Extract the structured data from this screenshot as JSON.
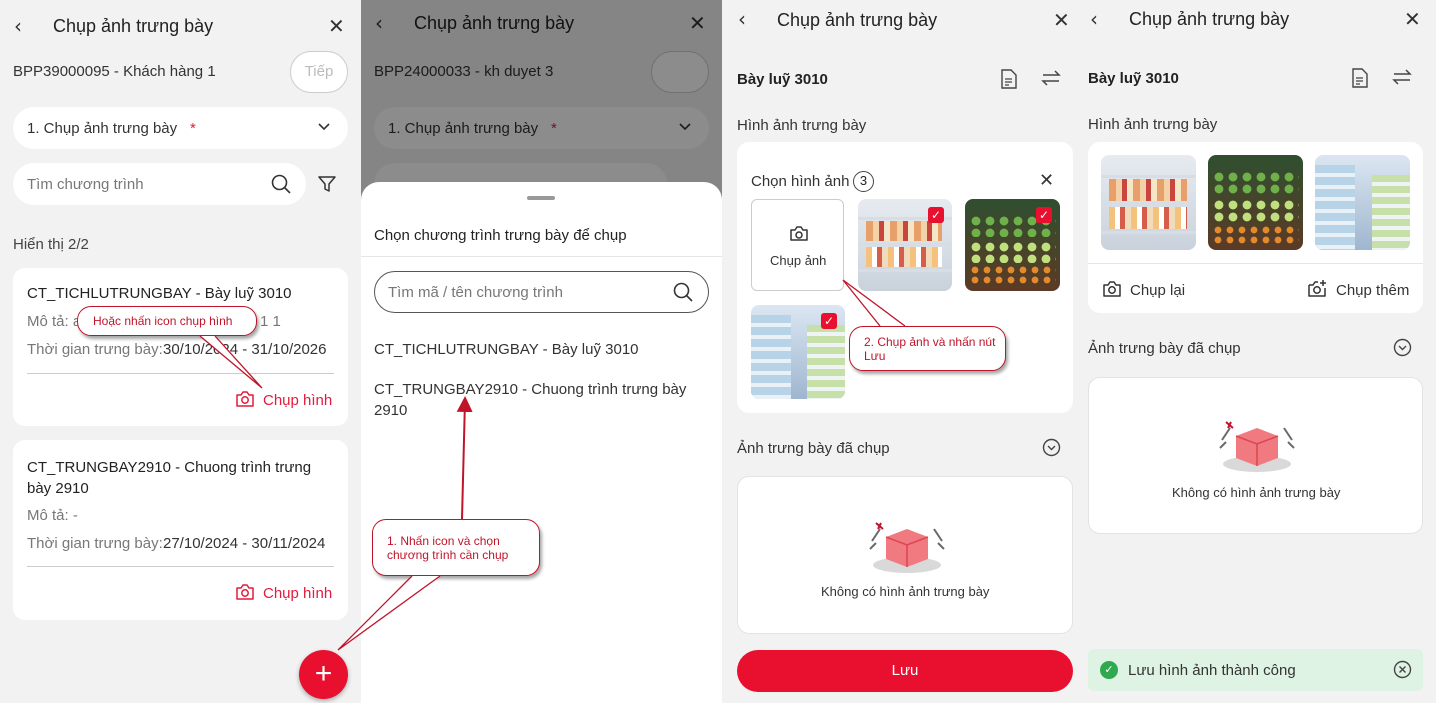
{
  "header": {
    "title": "Chụp ảnh trưng bày"
  },
  "s1": {
    "customer": "BPP39000095 - Khách hàng 1",
    "next_label": "Tiếp",
    "step_select": "1. Chụp ảnh trưng bày",
    "required_mark": "*",
    "search_placeholder": "Tìm chương trình",
    "count_label": "Hiển thị 2/2",
    "programs": [
      {
        "title": "CT_TICHLUTRUNGBAY - Bày luỹ 3010",
        "desc_label": "Mô tả: a",
        "desc_tail": "1 1",
        "time_label": "Thời gian trưng bày:",
        "time_value": "30/10/2024 - 31/10/2026",
        "action": "Chụp hình"
      },
      {
        "title": "CT_TRUNGBAY2910 - Chuong trình trưng bày 2910",
        "desc_label": "Mô tả: -",
        "time_label": "Thời gian trưng bày:",
        "time_value": "27/10/2024 - 30/11/2024",
        "action": "Chụp hình"
      }
    ],
    "fab": "+",
    "annotation": "Hoặc nhấn icon chụp hình"
  },
  "s2": {
    "customer": "BPP24000033 - kh duyet 3",
    "step_select": "1. Chụp ảnh trưng bày",
    "required_mark": "*",
    "sheet_title": "Chọn chương trình trưng bày để chụp",
    "search_placeholder": "Tìm mã / tên chương trình",
    "options": [
      "CT_TICHLUTRUNGBAY - Bày luỹ 3010",
      "CT_TRUNGBAY2910 - Chuong trình trưng bày 2910"
    ],
    "annotation": "1. Nhấn icon và chọn chương trình cần chụp"
  },
  "s3": {
    "program_name": "Bày luỹ 3010",
    "section_title": "Hình ảnh trưng bày",
    "pick_label": "Chọn hình ảnh",
    "pick_count": "3",
    "camera_label": "Chụp ảnh",
    "captured_title": "Ảnh trưng bày đã chụp",
    "empty_text": "Không có hình ảnh trưng bày",
    "save_label": "Lưu",
    "annotation": "2. Chụp ảnh và nhấn nút Lưu"
  },
  "s4": {
    "program_name": "Bày luỹ 3010",
    "section_title": "Hình ảnh trưng bày",
    "retake_label": "Chụp lại",
    "more_label": "Chụp thêm",
    "captured_title": "Ảnh trưng bày đã chụp",
    "empty_text": "Không có hình ảnh trưng bày",
    "toast": "Lưu hình ảnh thành công"
  },
  "colors": {
    "accent": "#e8102e",
    "success_bg": "#dff3e4",
    "success_icon": "#2fa84f"
  }
}
